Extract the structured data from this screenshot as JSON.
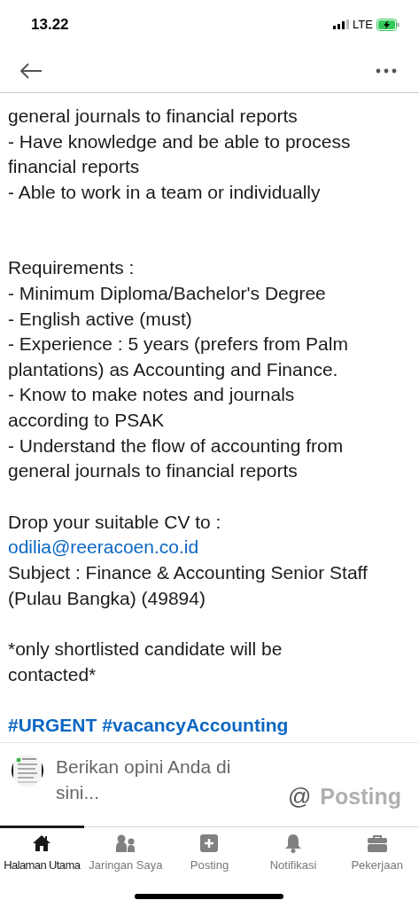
{
  "status_bar": {
    "time": "13.22",
    "network": "LTE"
  },
  "post": {
    "blocks": [
      {
        "lines": [
          {
            "kind": "text",
            "text": "general journals to financial reports"
          },
          {
            "kind": "text",
            "text": "- Have knowledge and be able to process"
          },
          {
            "kind": "text",
            "text": "financial reports"
          },
          {
            "kind": "text",
            "text": "- Able to work in a team or individually"
          }
        ]
      },
      {
        "lines": [
          {
            "kind": "text",
            "text": "Requirements :"
          },
          {
            "kind": "text",
            "text": "- Minimum Diploma/Bachelor's Degree"
          },
          {
            "kind": "text",
            "text": "- English active (must)"
          },
          {
            "kind": "text",
            "text": "- Experience : 5 years (prefers from Palm"
          },
          {
            "kind": "text",
            "text": "plantations) as Accounting and Finance."
          },
          {
            "kind": "text",
            "text": "- Know to make notes and journals"
          },
          {
            "kind": "text",
            "text": "according to PSAK"
          },
          {
            "kind": "text",
            "text": "- Understand the flow of accounting from"
          },
          {
            "kind": "text",
            "text": "general journals to financial reports"
          }
        ]
      },
      {
        "lines": [
          {
            "kind": "text",
            "text": "Drop your suitable CV to :"
          },
          {
            "kind": "link",
            "text": "odilia@reeracoen.co.id"
          },
          {
            "kind": "text",
            "text": "Subject : Finance & Accounting Senior Staff"
          },
          {
            "kind": "text",
            "text": "(Pulau Bangka) (49894)"
          }
        ]
      },
      {
        "lines": [
          {
            "kind": "text",
            "text": "*only shortlisted candidate will be"
          },
          {
            "kind": "text",
            "text": "contacted*"
          }
        ]
      },
      {
        "lines": [
          {
            "kind": "hashtags",
            "tags": [
              "#URGENT",
              "#vacancyAccounting"
            ]
          }
        ]
      }
    ]
  },
  "comment_box": {
    "placeholder": "Berikan opini Anda di sini...",
    "mention": "@",
    "submit": {
      "label": "Posting",
      "disabled": true
    }
  },
  "nav": [
    {
      "label": "Halaman Utama",
      "selected": true
    },
    {
      "label": "Jaringan Saya",
      "selected": false
    },
    {
      "label": "Posting",
      "selected": false
    },
    {
      "label": "Notifikasi",
      "selected": false
    },
    {
      "label": "Pekerjaan",
      "selected": false
    }
  ]
}
